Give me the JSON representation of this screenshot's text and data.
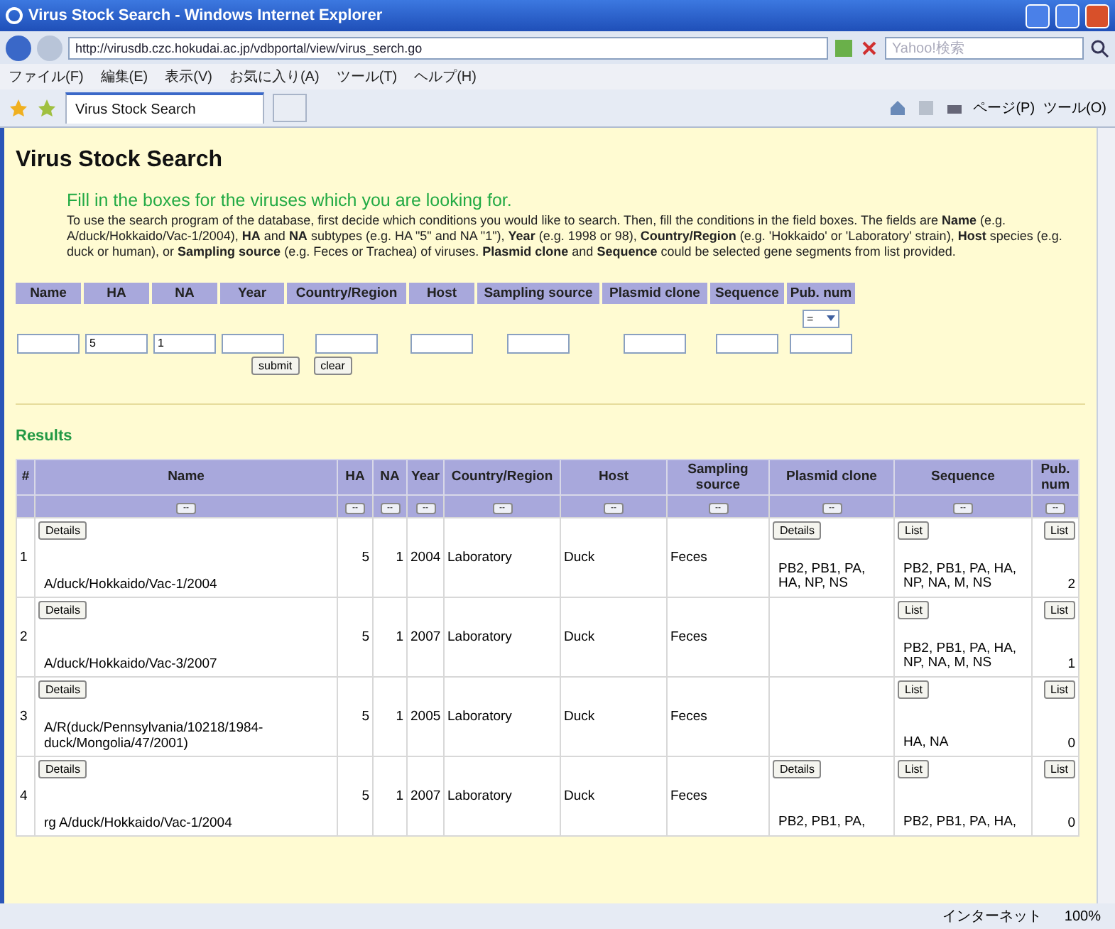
{
  "window": {
    "title": "Virus Stock Search - Windows Internet Explorer"
  },
  "address_bar": {
    "url": "http://virusdb.czc.hokudai.ac.jp/vdbportal/view/virus_serch.go",
    "search_placeholder": "Yahoo!検索"
  },
  "menu": [
    "ファイル(F)",
    "編集(E)",
    "表示(V)",
    "お気に入り(A)",
    "ツール(T)",
    "ヘルプ(H)"
  ],
  "tabs": [
    {
      "label": "Virus Stock Search",
      "selected": true
    }
  ],
  "command_bar": [
    "ページ(P)",
    "ツール(O)"
  ],
  "page": {
    "heading": "Virus Stock Search",
    "lead": "Fill in the boxes for the viruses which you are looking for.",
    "instructions": "To use the search program of the database, first decide which conditions you would like to search.  Then, fill the conditions in the field boxes.  The fields are **Name** (e.g. A/duck/Hokkaido/Vac-1/2004), **HA** and **NA** subtypes (e.g. HA \"5\" and NA \"1\"), **Year** (e.g. 1998 or 98), **Country/Region** (e.g. 'Hokkaido' or 'Laboratory' strain), **Host** species (e.g. duck or human), or **Sampling source** (e.g. Feces or Trachea) of viruses.  **Plasmid clone** and **Sequence** could be selected gene segments from list provided.",
    "search_fields": [
      {
        "label": "Name"
      },
      {
        "label": "HA",
        "value": "5"
      },
      {
        "label": "NA",
        "value": "1"
      },
      {
        "label": "Year"
      },
      {
        "label": "Country/Region"
      },
      {
        "label": "Host"
      },
      {
        "label": "Sampling source"
      },
      {
        "label": "Plasmid clone"
      },
      {
        "label": "Sequence"
      },
      {
        "label": "Pub. num",
        "operator": "="
      }
    ],
    "buttons": [
      "submit",
      "clear"
    ],
    "results_heading": "Results",
    "table": {
      "columns": [
        "#",
        "Name",
        "HA",
        "NA",
        "Year",
        "Country/Region",
        "Host",
        "Sampling source",
        "Plasmid clone",
        "Sequence",
        "Pub. num"
      ],
      "filter_label": "--",
      "rows": [
        {
          "index": "1",
          "details": "Details",
          "name": "A/duck/Hokkaido/Vac-1/2004",
          "ha": "5",
          "na": "1",
          "year": "2004",
          "country": "Laboratory",
          "host": "Duck",
          "source": "Feces",
          "plasmid": {
            "button": "Details",
            "genes": "PB2, PB1, PA, HA, NP, NS"
          },
          "sequence": {
            "button": "List",
            "genes": "PB2, PB1, PA, HA, NP, NA, M, NS"
          },
          "pub": {
            "button": "List",
            "count": "2"
          }
        },
        {
          "index": "2",
          "details": "Details",
          "name": "A/duck/Hokkaido/Vac-3/2007",
          "ha": "5",
          "na": "1",
          "year": "2007",
          "country": "Laboratory",
          "host": "Duck",
          "source": "Feces",
          "sequence": {
            "button": "List",
            "genes": "PB2, PB1, PA, HA, NP, NA, M, NS"
          },
          "pub": {
            "button": "List",
            "count": "1"
          }
        },
        {
          "index": "3",
          "details": "Details",
          "name": "A/R(duck/Pennsylvania/10218/1984-duck/Mongolia/47/2001)",
          "ha": "5",
          "na": "1",
          "year": "2005",
          "country": "Laboratory",
          "host": "Duck",
          "source": "Feces",
          "sequence": {
            "button": "List",
            "genes": "HA, NA"
          },
          "pub": {
            "button": "List",
            "count": "0"
          }
        },
        {
          "index": "4",
          "details": "Details",
          "name": "rg A/duck/Hokkaido/Vac-1/2004",
          "ha": "5",
          "na": "1",
          "year": "2007",
          "country": "Laboratory",
          "host": "Duck",
          "source": "Feces",
          "plasmid": {
            "button": "Details",
            "genes": "PB2, PB1, PA,"
          },
          "sequence": {
            "button": "List",
            "genes": "PB2, PB1, PA, HA,"
          },
          "pub": {
            "button": "List",
            "count": "0"
          }
        }
      ]
    }
  },
  "status_bar": {
    "zone": "インターネット",
    "zoom": "100%"
  }
}
